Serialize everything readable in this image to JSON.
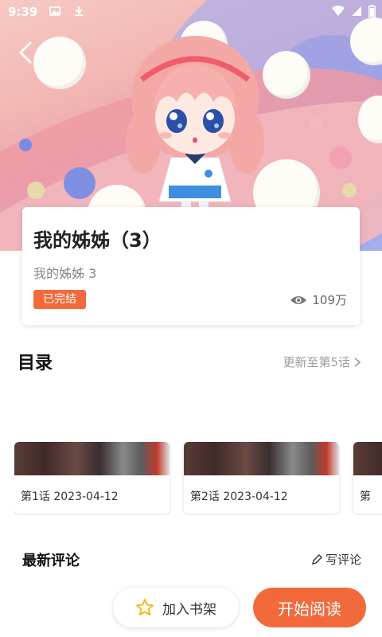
{
  "status_bar": {
    "time": "9:39"
  },
  "comic": {
    "title": "我的姊姊（3）",
    "subtitle": "我的姊姊 3",
    "status": "已完结",
    "views": "109万"
  },
  "catalog": {
    "title": "目录",
    "update_text": "更新至第5话",
    "chapters": [
      {
        "label": "第1话 2023-04-12"
      },
      {
        "label": "第2话 2023-04-12"
      },
      {
        "label": "第"
      }
    ]
  },
  "comments": {
    "title": "最新评论",
    "write_label": "写评论"
  },
  "bottom_bar": {
    "shelf_label": "加入书架",
    "read_label": "开始阅读"
  },
  "colors": {
    "accent": "#f26a3b"
  },
  "icons": [
    "back-arrow-icon",
    "eye-icon",
    "chevron-right-icon",
    "pencil-icon",
    "star-icon",
    "wifi-icon",
    "signal-icon",
    "battery-icon",
    "image-icon",
    "download-icon"
  ]
}
